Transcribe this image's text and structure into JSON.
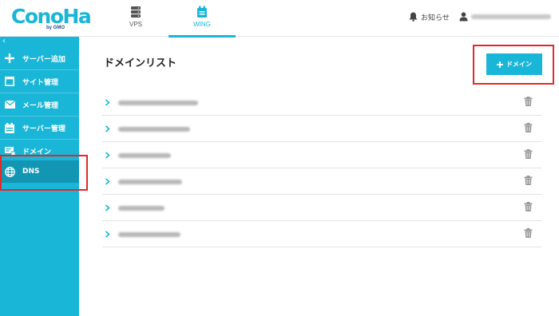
{
  "header": {
    "logo_text": "ConoHa",
    "logo_sub": "by GMO",
    "tabs": [
      {
        "label": "VPS",
        "icon": "server-icon"
      },
      {
        "label": "WING",
        "icon": "wing-icon"
      }
    ],
    "notification_label": "お知らせ",
    "user_email": ""
  },
  "sidebar": {
    "collapse_icon": "chevron-left-icon",
    "items": [
      {
        "label": "サーバー追加",
        "icon": "plus-icon"
      },
      {
        "label": "サイト管理",
        "icon": "site-icon"
      },
      {
        "label": "メール管理",
        "icon": "mail-icon"
      },
      {
        "label": "サーバー管理",
        "icon": "server-manage-icon"
      },
      {
        "label": "ドメイン",
        "icon": "domain-icon"
      },
      {
        "label": "DNS",
        "icon": "globe-icon",
        "active": true
      }
    ]
  },
  "main": {
    "title": "ドメインリスト",
    "add_button_label": "ドメイン",
    "domains": [
      {
        "name": ""
      },
      {
        "name": ""
      },
      {
        "name": ""
      },
      {
        "name": ""
      },
      {
        "name": ""
      },
      {
        "name": ""
      }
    ]
  },
  "colors": {
    "accent": "#19b6d8",
    "sidebar_active": "#1396b4",
    "annotation": "#e02a2a"
  }
}
